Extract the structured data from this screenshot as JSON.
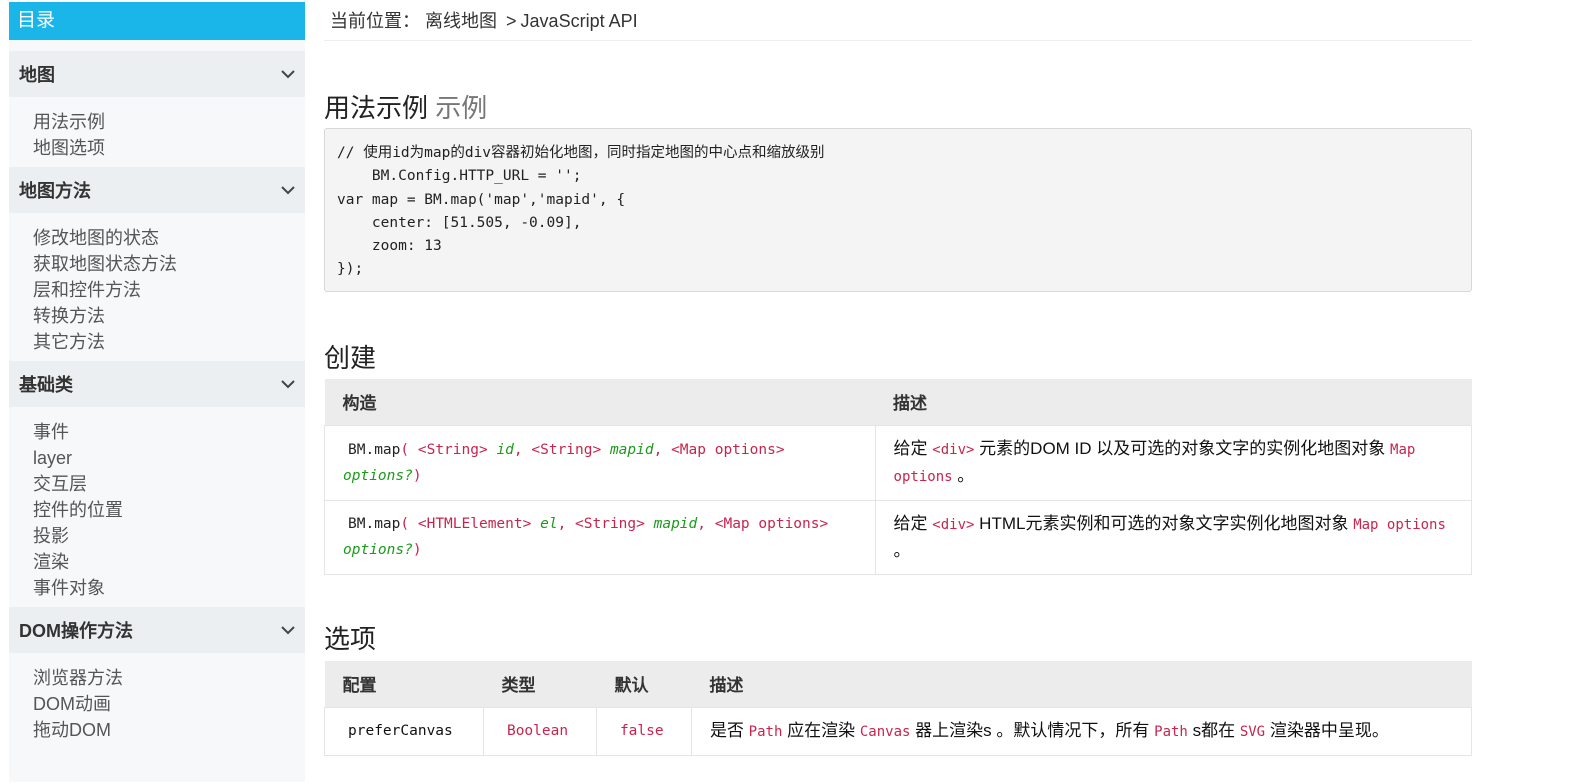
{
  "sidebar": {
    "header": "目录",
    "groups": [
      {
        "title": "地图",
        "items": [
          "用法示例",
          "地图选项"
        ]
      },
      {
        "title": "地图方法",
        "items": [
          "修改地图的状态",
          "获取地图状态方法",
          "层和控件方法",
          "转换方法",
          "其它方法"
        ]
      },
      {
        "title": "基础类",
        "items": [
          "事件",
          "layer",
          "交互层",
          "控件的位置",
          "投影",
          "渲染",
          "事件对象"
        ]
      },
      {
        "title": "DOM操作方法",
        "items": [
          "浏览器方法",
          "DOM动画",
          "拖动DOM"
        ]
      }
    ]
  },
  "breadcrumb": {
    "prefix": "当前位置：",
    "parent": "离线地图",
    "separator": ">",
    "current": "JavaScript API"
  },
  "usage": {
    "title": "用法示例",
    "subtitle": "示例",
    "code": "// 使用id为map的div容器初始化地图，同时指定地图的中心点和缩放级别\n    BM.Config.HTTP_URL = '';\nvar map = BM.map('map','mapid', {\n    center: [51.505, -0.09],\n    zoom: 13\n});"
  },
  "create": {
    "title": "创建",
    "headers": [
      "构造",
      "描述"
    ],
    "rows": [
      {
        "fn": "BM.map",
        "open": "(",
        "t1": "<String>",
        "a1": "id",
        "t2": "<String>",
        "a2": "mapid",
        "t3": "<Map options>",
        "a3": "options?",
        "close": ")",
        "desc_pre": "给定",
        "desc_code": "<div>",
        "desc_mid": "元素的DOM ID 以及可选的对象文字的实例化地图对象",
        "desc_code2": "Map options",
        "desc_post": "。"
      },
      {
        "fn": "BM.map",
        "open": "(",
        "t1": "<HTMLElement>",
        "a1": "el",
        "t2": "<String>",
        "a2": "mapid",
        "t3": "<Map options>",
        "a3": "options?",
        "close": ")",
        "desc_pre": "给定",
        "desc_code": "<div>",
        "desc_mid": "HTML元素实例和可选的对象文字实例化地图对象",
        "desc_code2": "Map options",
        "desc_post": "。"
      }
    ]
  },
  "options": {
    "title": "选项",
    "headers": [
      "配置",
      "类型",
      "默认",
      "描述"
    ],
    "rows": [
      {
        "name": "preferCanvas",
        "type": "Boolean",
        "default": "false",
        "d1": "是否",
        "c1": "Path",
        "d2": "应在渲染",
        "c2": "Canvas",
        "d3": "器上渲染s 。默认情况下，所有",
        "c3": "Path",
        "d4": "s都在",
        "c4": "SVG",
        "d5": "渲染器中呈现。"
      }
    ]
  },
  "colors": {
    "accent": "#1ab6ea",
    "code_red": "#c7254e",
    "arg_green": "#1a9b1a"
  },
  "icons": {
    "group_toggle": "chevron-down-icon"
  }
}
